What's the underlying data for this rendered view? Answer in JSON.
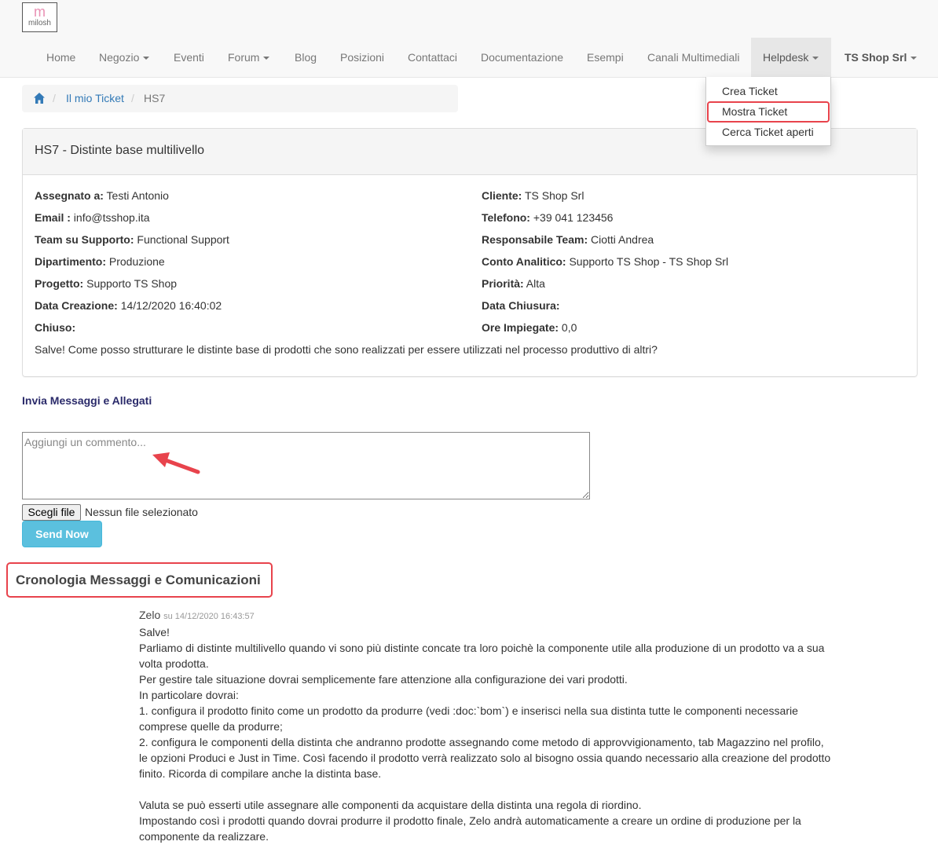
{
  "logo": {
    "mark": "m",
    "word": "milosh"
  },
  "nav": {
    "items": [
      "Home",
      "Negozio",
      "Eventi",
      "Forum",
      "Blog",
      "Posizioni",
      "Contattaci",
      "Documentazione",
      "Esempi",
      "Canali Multimediali",
      "Helpdesk",
      "TS Shop Srl"
    ]
  },
  "dropdown": {
    "items": [
      "Crea Ticket",
      "Mostra Ticket",
      "Cerca Ticket aperti"
    ],
    "highlighted": "Mostra Ticket"
  },
  "breadcrumb": {
    "home_icon": "home-icon",
    "separator": "/",
    "link": "Il mio Ticket",
    "current": "HS7"
  },
  "ticket": {
    "title": "HS7 - Distinte base multilivello",
    "left": [
      {
        "label": "Assegnato a:",
        "value": " Testi Antonio"
      },
      {
        "label": "Email :",
        "value": " info@tsshop.ita"
      },
      {
        "label": "Team su Supporto:",
        "value": " Functional Support"
      },
      {
        "label": "Dipartimento:",
        "value": " Produzione"
      },
      {
        "label": "Progetto:",
        "value": " Supporto TS Shop"
      },
      {
        "label": "Data Creazione:",
        "value": " 14/12/2020 16:40:02"
      },
      {
        "label": "Chiuso:",
        "value": ""
      }
    ],
    "right": [
      {
        "label": "Cliente:",
        "value": " TS Shop Srl"
      },
      {
        "label": "Telefono:",
        "value": " +39 041 123456"
      },
      {
        "label": "Responsabile Team:",
        "value": " Ciotti Andrea"
      },
      {
        "label": "Conto Analitico:",
        "value": " Supporto TS Shop - TS Shop Srl"
      },
      {
        "label": "Priorità:",
        "value": " Alta"
      },
      {
        "label": "Data Chiusura:",
        "value": ""
      },
      {
        "label": "Ore Impiegate:",
        "value": " 0,0"
      }
    ],
    "description": "Salve! Come posso strutturare le distinte base di prodotti che sono realizzati per essere utilizzati nel processo produttivo di altri?"
  },
  "compose": {
    "section_label": "Invia Messaggi e Allegati",
    "comment_placeholder": "Aggiungi un commento...",
    "file_button": "Scegli file",
    "file_status": "Nessun file selezionato",
    "send_label": "Send Now"
  },
  "history": {
    "title": "Cronologia Messaggi e Comunicazioni",
    "message": {
      "author": "Zelo",
      "on": "su 14/12/2020 16:43:57",
      "lines": [
        "Salve!",
        "Parliamo di distinte multilivello quando vi sono più distinte concate tra loro poichè la componente utile alla produzione di un prodotto va a sua",
        "volta prodotta.",
        "Per gestire tale situazione dovrai semplicemente fare attenzione alla configurazione dei vari prodotti.",
        "In particolare dovrai:",
        "1. configura il prodotto finito come un prodotto da produrre (vedi :doc:`bom`) e inserisci nella sua distinta tutte le componenti necessarie",
        "comprese quelle da produrre;",
        "2. configura le componenti della distinta che andranno prodotte assegnando come metodo di approvvigionamento, tab Magazzino nel profilo,",
        "le opzioni Produci e Just in Time. Così facendo il prodotto verrà realizzato solo al bisogno ossia quando necessario alla creazione del prodotto",
        "finito. Ricorda di compilare anche la distinta base.",
        "",
        "Valuta se può esserti utile assegnare alle componenti da acquistare della distinta una regola di riordino.",
        "Impostando così i prodotti quando dovrai produrre il prodotto finale, Zelo andrà automaticamente a creare un ordine di produzione per la",
        "componente da realizzare."
      ]
    }
  },
  "colors": {
    "accent": "#5bc0de",
    "highlight": "#e8434c",
    "link": "#337ab7",
    "logo": "#e991b4"
  }
}
